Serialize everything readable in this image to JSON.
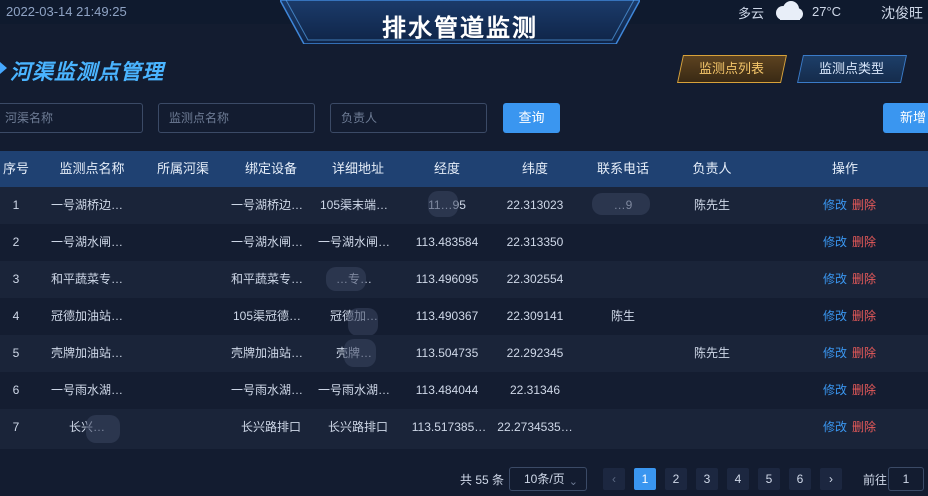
{
  "header": {
    "datetime": "2022-03-14 21:49:25",
    "title": "排水管道监测",
    "weather": "多云",
    "temperature": "27°C",
    "user": "沈俊旺"
  },
  "section": {
    "title": "河渠监测点管理"
  },
  "tabs": {
    "list": "监测点列表",
    "type": "监测点类型"
  },
  "filters": {
    "river_placeholder": "河渠名称",
    "point_placeholder": "监测点名称",
    "person_placeholder": "负责人",
    "query_label": "查询",
    "add_label": "新增"
  },
  "table": {
    "headers": [
      "序号",
      "监测点名称",
      "所属河渠",
      "绑定设备",
      "详细地址",
      "经度",
      "纬度",
      "联系电话",
      "负责人",
      "操作"
    ],
    "edit_label": "修改",
    "delete_label": "删除",
    "rows": [
      {
        "no": "1",
        "name": "一号湖桥边…",
        "river": "",
        "device": "一号湖桥边…",
        "address": "105渠末端…",
        "lng": "11…95",
        "lat": "22.313023",
        "phone": "…9",
        "person": "陈先生"
      },
      {
        "no": "2",
        "name": "一号湖水闸…",
        "river": "",
        "device": "一号湖水闸…",
        "address": "一号湖水闸…",
        "lng": "113.483584",
        "lat": "22.313350",
        "phone": "",
        "person": ""
      },
      {
        "no": "3",
        "name": "和平蔬菜专…",
        "river": "",
        "device": "和平蔬菜专…",
        "address": "…专…",
        "lng": "113.496095",
        "lat": "22.302554",
        "phone": "",
        "person": ""
      },
      {
        "no": "4",
        "name": "冠德加油站…",
        "river": "",
        "device": "105渠冠德…",
        "address": "冠德加…",
        "lng": "113.490367",
        "lat": "22.309141",
        "phone": "陈生",
        "person": ""
      },
      {
        "no": "5",
        "name": "壳牌加油站…",
        "river": "",
        "device": "壳牌加油站…",
        "address": "壳牌…",
        "lng": "113.504735",
        "lat": "22.292345",
        "phone": "",
        "person": "陈先生"
      },
      {
        "no": "6",
        "name": "一号雨水湖…",
        "river": "",
        "device": "一号雨水湖…",
        "address": "一号雨水湖…",
        "lng": "113.484044",
        "lat": "22.31346",
        "phone": "",
        "person": ""
      },
      {
        "no": "7",
        "name": "长兴…",
        "river": "",
        "device": "长兴路排口",
        "address": "长兴路排口",
        "lng": "113.517385…",
        "lat": "22.2734535…",
        "phone": "",
        "person": ""
      }
    ]
  },
  "pagination": {
    "total": "共 55 条",
    "page_size": "10条/页",
    "prev": "‹",
    "next": "›",
    "pages": [
      "1",
      "2",
      "3",
      "4",
      "5",
      "6"
    ],
    "active_page": "1",
    "goto_label": "前往",
    "goto_value": "1"
  }
}
